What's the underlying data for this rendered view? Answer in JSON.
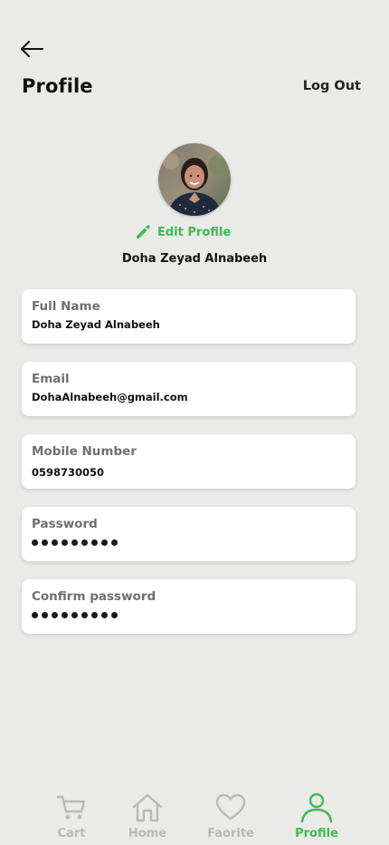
{
  "header": {
    "title": "Profile",
    "logout_label": "Log Out",
    "back_icon": "arrow-left-icon"
  },
  "profile": {
    "avatar": "user-photo",
    "edit_label": "Edit Profile",
    "name": "Doha Zeyad Alnabeeh"
  },
  "fields": [
    {
      "label": "Full Name",
      "value": "Doha Zeyad Alnabeeh"
    },
    {
      "label": "Email",
      "value": "DohaAlnabeeh@gmail.com"
    },
    {
      "label": "Mobile Number",
      "value": "0598730050"
    },
    {
      "label": "Password",
      "masked": true,
      "dot_count": 9
    },
    {
      "label": "Confirm password",
      "masked": true,
      "dot_count": 9
    }
  ],
  "nav": {
    "items": [
      {
        "label": "Cart",
        "icon": "cart-icon",
        "active": false
      },
      {
        "label": "Home",
        "icon": "home-icon",
        "active": false
      },
      {
        "label": "Faorite",
        "icon": "heart-icon",
        "active": false
      },
      {
        "label": "Profile",
        "icon": "person-icon",
        "active": true
      }
    ]
  },
  "colors": {
    "accent": "#3dbb4f",
    "background": "#eaeae8",
    "card": "#ffffff",
    "inactive": "#b9b9b9"
  }
}
